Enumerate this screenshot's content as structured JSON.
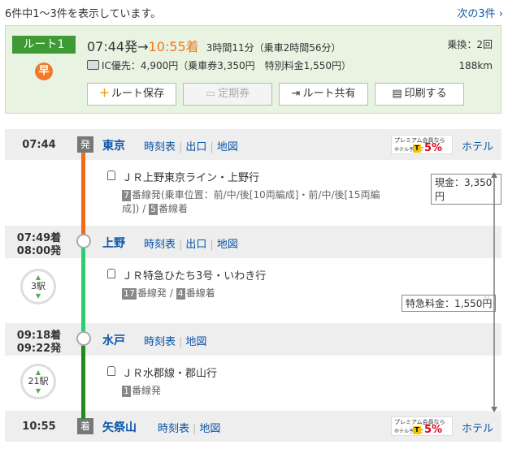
{
  "header": {
    "result_count": "6件中1～3件を表示しています。",
    "next_link": "次の3件"
  },
  "route": {
    "label": "ルート1",
    "fast_icon": "早",
    "dep": "07:44発",
    "arrow": "→",
    "arr": "10:55着",
    "duration": "3時間11分（乗車2時間56分）",
    "transfers": "乗換：2回",
    "fare": "IC優先：4,900円（乗車券3,350円　特別料金1,550円）",
    "distance": "188km",
    "buttons": {
      "save": "ルート保存",
      "pass": "定期券",
      "share": "ルート共有",
      "print": "印刷する"
    }
  },
  "stations": [
    {
      "time1": "07:44",
      "time2": "",
      "badge": "発",
      "name": "東京",
      "links": [
        "時刻表",
        "出口",
        "地図"
      ]
    },
    {
      "time1": "07:49着",
      "time2": "08:00発",
      "badge": "",
      "name": "上野",
      "links": [
        "時刻表",
        "出口",
        "地図"
      ]
    },
    {
      "time1": "09:18着",
      "time2": "09:22発",
      "badge": "",
      "name": "水戸",
      "links": [
        "時刻表",
        "地図"
      ]
    },
    {
      "time1": "10:55",
      "time2": "",
      "badge": "着",
      "name": "矢祭山",
      "links": [
        "時刻表",
        "地図"
      ]
    }
  ],
  "segments": [
    {
      "train": "ＪＲ上野東京ライン・上野行",
      "plat_from_num": "7",
      "plat_from": "番線発(乗車位置：前/中/後[10両編成]・前/中/後[15両編",
      "plat_from2": "成])",
      "plat_to_num": "5",
      "plat_to": "番線着",
      "stops": "",
      "fare_box": "現金：3,350円"
    },
    {
      "train": "ＪＲ特急ひたち3号・いわき行",
      "plat_from_num": "17",
      "plat_from": "番線発",
      "plat_to_num": "4",
      "plat_to": "番線着",
      "stops": "3駅",
      "fare_box": "特急料金：1,550円"
    },
    {
      "train": "ＪＲ水郡線・郡山行",
      "plat_from_num": "1",
      "plat_from": "番線発",
      "plat_to_num": "",
      "plat_to": "",
      "stops": "21駅",
      "fare_box": ""
    }
  ],
  "promo": {
    "line1": "プレミアム会員なら",
    "line2": "ホテル予約で",
    "tlogo": "T",
    "pct": "5%",
    "hotel": "ホテル"
  },
  "colors": {
    "line1": "#f26b1d",
    "line2": "#2ecc71",
    "line3": "#1f8a1f",
    "accent_green": "#3d9a34",
    "link_blue": "#0b55a8"
  }
}
